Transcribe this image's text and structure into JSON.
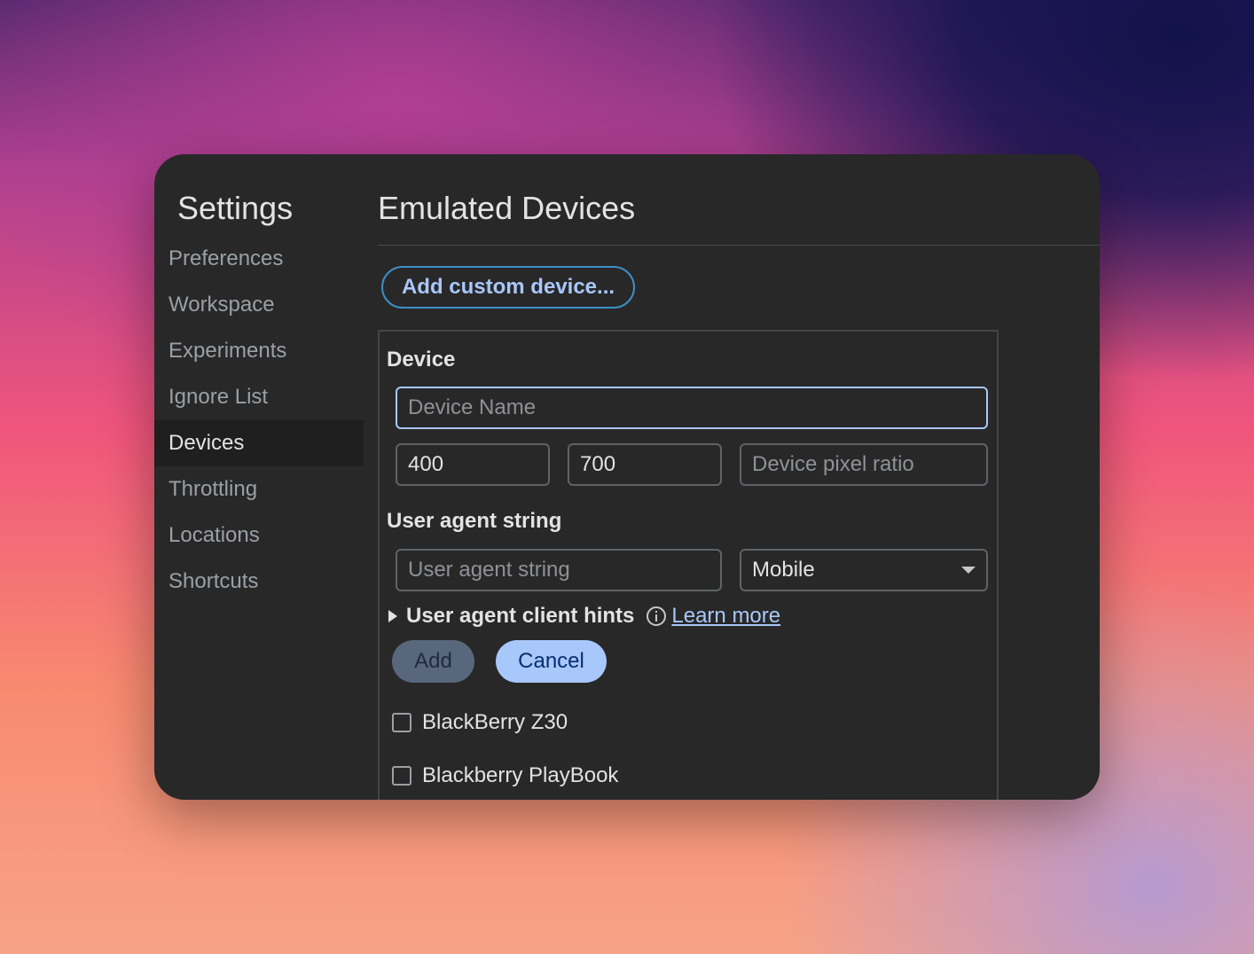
{
  "sidebar": {
    "title": "Settings",
    "items": [
      {
        "label": "Preferences"
      },
      {
        "label": "Workspace"
      },
      {
        "label": "Experiments"
      },
      {
        "label": "Ignore List"
      },
      {
        "label": "Devices",
        "selected": true
      },
      {
        "label": "Throttling"
      },
      {
        "label": "Locations"
      },
      {
        "label": "Shortcuts"
      }
    ]
  },
  "main": {
    "title": "Emulated Devices",
    "add_custom_label": "Add custom device..."
  },
  "editor": {
    "device_heading": "Device",
    "device_name_placeholder": "Device Name",
    "width_value": "400",
    "height_value": "700",
    "pixel_ratio_placeholder": "Device pixel ratio",
    "ua_heading": "User agent string",
    "ua_placeholder": "User agent string",
    "ua_type_selected": "Mobile",
    "client_hints_label": "User agent client hints",
    "learn_more_label": "Learn more",
    "add_label": "Add",
    "cancel_label": "Cancel"
  },
  "devices": [
    {
      "name": "BlackBerry Z30",
      "checked": false
    },
    {
      "name": "Blackberry PlayBook",
      "checked": false
    }
  ],
  "colors": {
    "accent": "#a8c7fa",
    "window_bg": "#282828",
    "selected_nav_bg": "#1f1f1f"
  },
  "icons": [
    "info-icon",
    "expand-triangle-icon",
    "dropdown-caret-icon"
  ]
}
